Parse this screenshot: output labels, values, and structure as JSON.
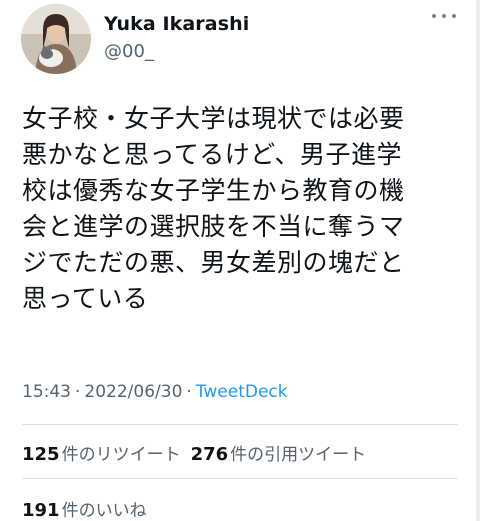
{
  "header": {
    "display_name": "Yuka Ikarashi",
    "handle": "@00_"
  },
  "tweet": {
    "text": "女子校・女子大学は現状では必要\n悪かなと思ってるけど、男子進学\n校は優秀な女子学生から教育の機\n会と進学の選択肢を不当に奪うマ\nジでただの悪、男女差別の塊だと\n思っている",
    "time": "15:43",
    "date": "2022/06/30",
    "source": "TweetDeck"
  },
  "stats": {
    "retweets_count": "125",
    "retweets_label": "件のリツイート",
    "quotes_count": "276",
    "quotes_label": "件の引用ツイート",
    "likes_count": "191",
    "likes_label": "件のいいね"
  },
  "icons": {
    "more": "more-horizontal-icon",
    "avatar": "profile-photo"
  },
  "colors": {
    "text": "#0f1419",
    "secondary": "#536471",
    "link": "#1d9bf0",
    "divider": "#dadfe3"
  }
}
